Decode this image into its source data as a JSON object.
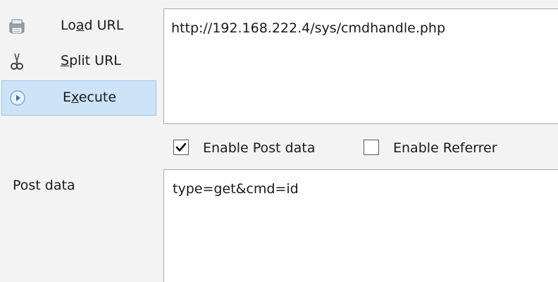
{
  "actions": {
    "load": {
      "label_pre": "Lo",
      "label_accel": "a",
      "label_post": "d URL"
    },
    "split": {
      "label_pre": "",
      "label_accel": "S",
      "label_post": "plit URL"
    },
    "execute": {
      "label_pre": "E",
      "label_accel": "x",
      "label_post": "ecute"
    }
  },
  "url_field": {
    "value": "http://192.168.222.4/sys/cmdhandle.php"
  },
  "options": {
    "enable_post": {
      "label": "Enable Post data",
      "checked": true
    },
    "enable_referrer": {
      "label": "Enable Referrer",
      "checked": false
    }
  },
  "post": {
    "label": "Post data",
    "value": "type=get&cmd=id"
  },
  "colors": {
    "selected_bg": "#cde3f7",
    "selected_border": "#9ec5ea",
    "field_border": "#a9a9a9"
  }
}
